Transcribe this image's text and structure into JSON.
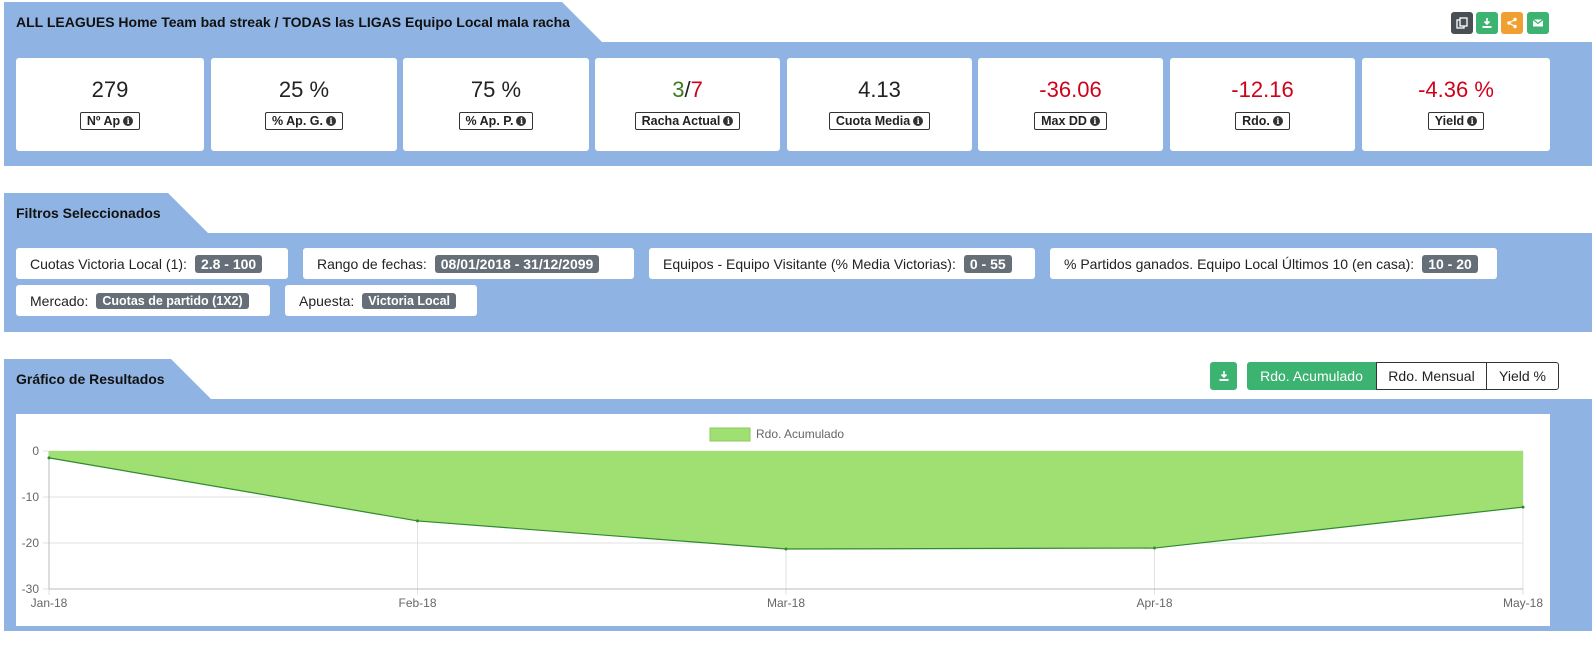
{
  "header": {
    "title": "ALL LEAGUES Home Team bad streak / TODAS las LIGAS Equipo Local mala racha",
    "icons": [
      "copy-icon",
      "download-icon",
      "share-icon",
      "email-icon"
    ],
    "icon_colors": [
      "#4a4f55",
      "#3cb371",
      "#f0a030",
      "#3cb371"
    ]
  },
  "stats": [
    {
      "value": "279",
      "label": "Nº Ap"
    },
    {
      "value": "25 %",
      "label": "% Ap. G."
    },
    {
      "value": "75 %",
      "label": "% Ap. P."
    },
    {
      "value_a": "3",
      "value_sep": "/",
      "value_b": "7",
      "label": "Racha Actual"
    },
    {
      "value": "4.13",
      "label": "Cuota Media"
    },
    {
      "value": "-36.06",
      "label": "Max DD"
    },
    {
      "value": "-12.16",
      "label": "Rdo."
    },
    {
      "value": "-4.36 %",
      "label": "Yield"
    }
  ],
  "filters": {
    "title": "Filtros Seleccionados",
    "items": [
      {
        "label": "Cuotas Victoria Local (1):",
        "value": "2.8 - 100"
      },
      {
        "label": "Rango de fechas:",
        "value": "08/01/2018 - 31/12/2099"
      },
      {
        "label": "Equipos - Equipo Visitante (% Media Victorias):",
        "value": "0 - 55"
      },
      {
        "label": "% Partidos ganados. Equipo Local Últimos 10 (en casa):",
        "value": "10 - 20"
      },
      {
        "label": "Mercado:",
        "value": "Cuotas de partido (1X2)"
      },
      {
        "label": "Apuesta:",
        "value": "Victoria Local"
      }
    ]
  },
  "results": {
    "title": "Gráfico de Resultados",
    "buttons": {
      "active": "Rdo. Acumulado",
      "monthly": "Rdo. Mensual",
      "yield": "Yield %"
    }
  },
  "colors": {
    "accent_green": "#3cb371",
    "band_blue": "#8fb4e3",
    "negative_red": "#d0021b",
    "positive_green": "#3c7a1c",
    "area_fill": "#a0e072",
    "area_line": "#2e8b2e"
  },
  "chart_data": {
    "type": "area",
    "x": [
      "Jan-18",
      "Feb-18",
      "Mar-18",
      "Apr-18",
      "May-18"
    ],
    "series": [
      {
        "name": "Rdo. Acumulado",
        "values": [
          -1.5,
          -15.2,
          -21.3,
          -21.1,
          -12.2
        ]
      }
    ],
    "yticks": [
      "0",
      "-10",
      "-20",
      "-30"
    ],
    "ylim": [
      -30,
      0
    ],
    "legend": "top-center",
    "grid": true
  }
}
